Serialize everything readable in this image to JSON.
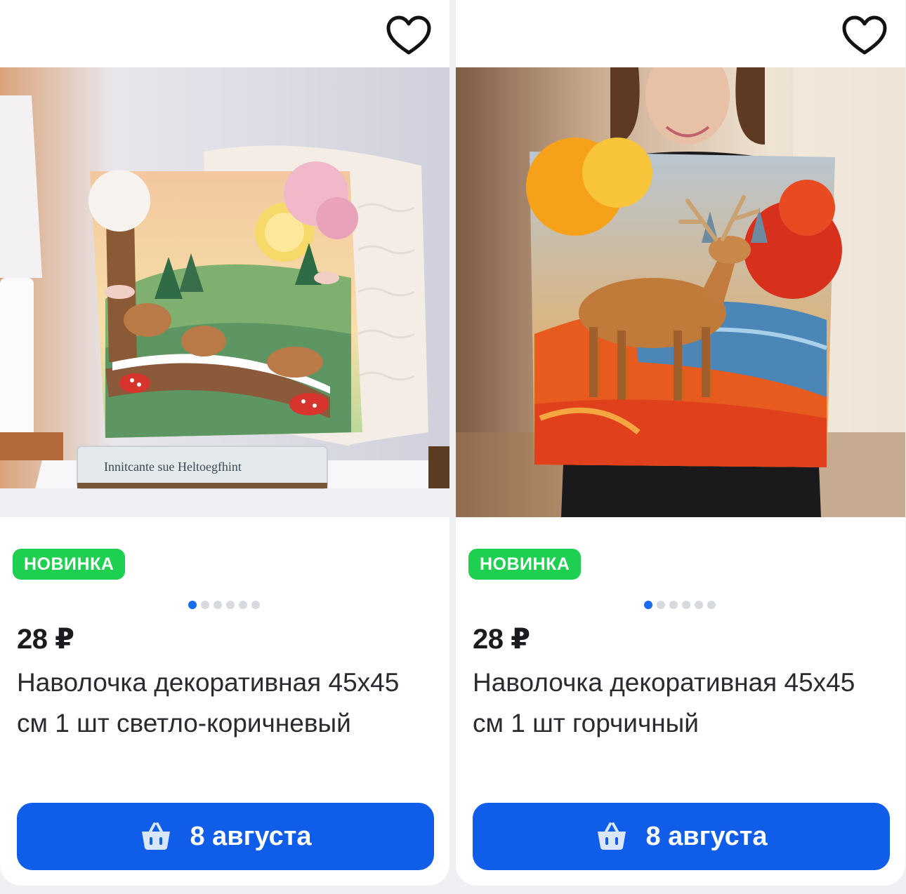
{
  "products": [
    {
      "badge": "НОВИНКА",
      "price": "28 ₽",
      "title": "Наволочка декоративная 45х45 см 1 шт светло-коричневый",
      "delivery": "8 августа",
      "carousel": {
        "total": 6,
        "active": 1
      },
      "photo_text": "Innitcante sue Heltoegfhint",
      "icons": {
        "favorite": "heart-outline-icon",
        "cart": "basket-icon"
      }
    },
    {
      "badge": "НОВИНКА",
      "price": "28 ₽",
      "title": "Наволочка декоративная 45х45 см 1 шт горчичный",
      "delivery": "8 августа",
      "carousel": {
        "total": 6,
        "active": 1
      },
      "icons": {
        "favorite": "heart-outline-icon",
        "cart": "basket-icon"
      }
    }
  ],
  "colors": {
    "badge_green": "#1fcf4f",
    "cta_blue": "#0f5de9",
    "dot_active": "#1a6cf2",
    "dot_inactive": "#d7dade"
  }
}
